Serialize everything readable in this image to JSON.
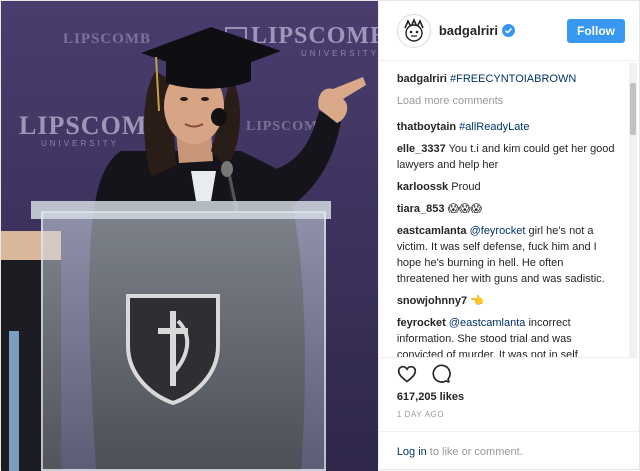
{
  "photo": {
    "backdrop_text": [
      "LIPSCOMB",
      "LIPSCOMB",
      "LIPSCOMB",
      "LIPSCOMB"
    ],
    "backdrop_subtext": "UNIVERSITY"
  },
  "header": {
    "username": "badgalriri",
    "follow_label": "Follow"
  },
  "caption": {
    "username": "badgalriri",
    "text": "#FREECYNTOIABROWN"
  },
  "load_more_label": "Load more comments",
  "comments": [
    {
      "user": "thatboytain",
      "mention": "",
      "text": "",
      "tag": "#allReadyLate"
    },
    {
      "user": "elle_3337",
      "mention": "",
      "text": "You t.i and kim could get her good lawyers and help her",
      "tag": ""
    },
    {
      "user": "karloossk",
      "mention": "",
      "text": "Proud",
      "tag": ""
    },
    {
      "user": "tiara_853",
      "mention": "",
      "text": "😱😱😱",
      "tag": ""
    },
    {
      "user": "eastcamlanta",
      "mention": "@feyrocket",
      "text": "girl he's not a victim. It was self defense, fuck him and I hope he's burning in hell. He often threatened her with guns and was sadistic.",
      "tag": ""
    },
    {
      "user": "snowjohnny7",
      "mention": "",
      "text": "👈",
      "tag": ""
    },
    {
      "user": "feyrocket",
      "mention": "@eastcamlanta",
      "text": "incorrect information. She stood trial and was convicted of murder. It was not in self defense. He did not threaten her life. He did not threaten her with weapons. She shot him with her own handgun. They were",
      "tag": ""
    }
  ],
  "likes": "617,205 likes",
  "timestamp": "1 DAY AGO",
  "login": {
    "link": "Log in",
    "text": "to like or comment."
  },
  "colors": {
    "accent": "#3897f0",
    "link": "#003569",
    "backdrop": "#3f3461"
  }
}
